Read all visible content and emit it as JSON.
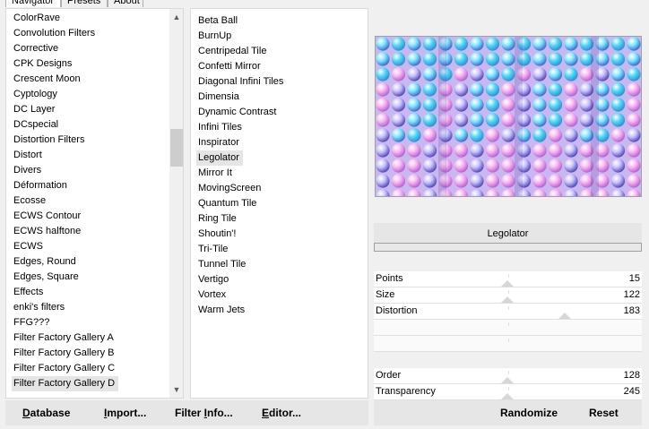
{
  "tabs": [
    {
      "label": "Navigator"
    },
    {
      "label": "Presets"
    },
    {
      "label": "About"
    }
  ],
  "categories": {
    "items": [
      "ColorRave",
      "Convolution Filters",
      "Corrective",
      "CPK Designs",
      "Crescent Moon",
      "Cyptology",
      "DC Layer",
      "DCspecial",
      "Distortion Filters",
      "Distort",
      "Divers",
      "Déformation",
      "Ecosse",
      "ECWS Contour",
      "ECWS halftone",
      "ECWS",
      "Edges, Round",
      "Edges, Square",
      "Effects",
      "enki's filters",
      "FFG???",
      "Filter Factory Gallery A",
      "Filter Factory Gallery B",
      "Filter Factory Gallery C",
      "Filter Factory Gallery D"
    ],
    "selected_index": 24
  },
  "filters": {
    "items": [
      "Beta Ball",
      "BurnUp",
      "Centripedal Tile",
      "Confetti Mirror",
      "Diagonal Infini Tiles",
      "Dimensia",
      "Dynamic Contrast",
      "Infini Tiles",
      "Inspirator",
      "Legolator",
      "Mirror It",
      "MovingScreen",
      "Quantum Tile",
      "Ring Tile",
      "Shoutin'!",
      "Tri-Tile",
      "Tunnel Tile",
      "Vertigo",
      "Vortex",
      "Warm Jets"
    ],
    "selected_index": 9
  },
  "filter_panel": {
    "title": "Legolator",
    "params": [
      {
        "label": "Points",
        "value": "15"
      },
      {
        "label": "Size",
        "value": "122"
      },
      {
        "label": "Distortion",
        "value": "183"
      },
      {
        "label": "",
        "value": ""
      },
      {
        "label": "",
        "value": ""
      },
      {
        "label": "Order",
        "value": "128"
      },
      {
        "label": "Transparency",
        "value": "245"
      }
    ]
  },
  "buttons": {
    "database": {
      "u": "D",
      "rest": "atabase"
    },
    "import": {
      "u": "I",
      "rest": "mport..."
    },
    "filter_info": {
      "u": "",
      "pre": "Filter ",
      "u2": "I",
      "rest": "nfo..."
    },
    "editor": {
      "u": "E",
      "rest": "ditor..."
    },
    "randomize": "Randomize",
    "reset": "Reset"
  },
  "colors": {
    "accent_cyan": "#3fd0f0",
    "accent_pink": "#f0a6e8",
    "accent_purple": "#5a4fb6"
  }
}
